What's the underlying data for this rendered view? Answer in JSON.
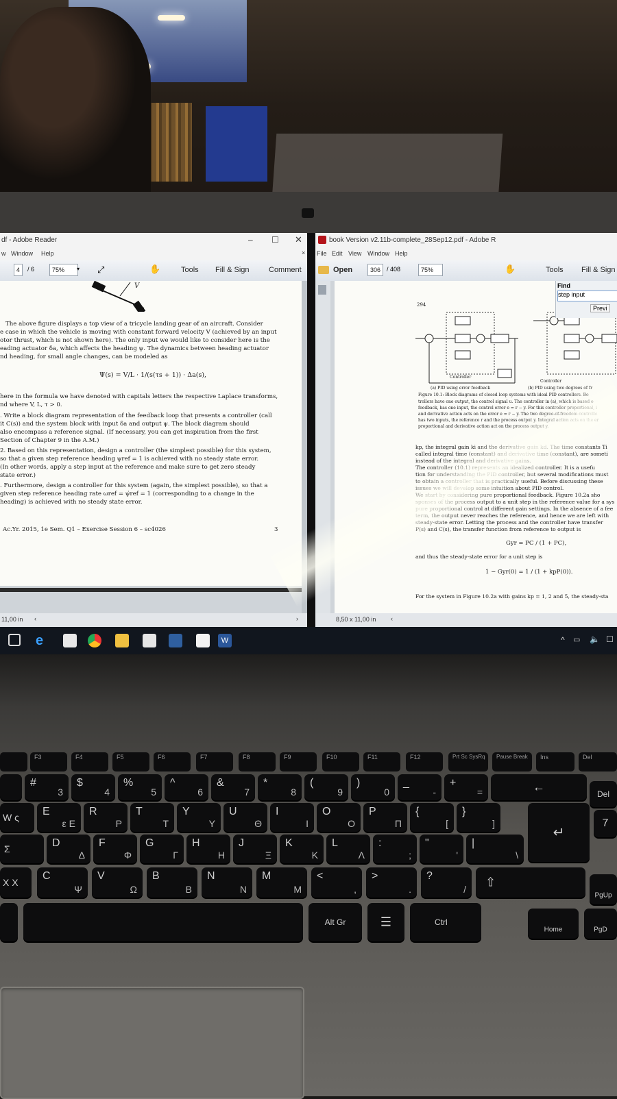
{
  "left_window": {
    "title": "df - Adobe Reader",
    "menu": [
      "w",
      "Window",
      "Help"
    ],
    "page_current": "4",
    "page_total": "/ 6",
    "zoom": "75%",
    "tools": [
      "Tools",
      "Fill & Sign",
      "Comment"
    ],
    "fig_label": "V",
    "lines": [
      "The above figure displays a top view of a tricycle landing gear of an aircraft.  Consider",
      "e case in which the vehicle is moving with constant forward velocity V (achieved by an input",
      "otor thrust, which is not shown here).  The only input we would like to consider here is the",
      "eading actuator δa, which affects the heading ψ.  The dynamics between heading actuator",
      "nd heading, for small angle changes, can be modeled as",
      "Ψ(s) =  V/L · 1/(s(τs + 1)) · Δa(s),",
      "here in the formula we have denoted with capitals letters the respective Laplace transforms,",
      "nd where V, L, τ > 0.",
      ".  Write a block diagram representation of the feedback loop that presents a controller (call",
      "   it C(s)) and the system block with input δa and output ψ. The block diagram should",
      "   also encompass a reference signal.  (If necessary, you can get inspiration from the first",
      "   Section of Chapter 9 in the A.M.)",
      "2.  Based on this representation, design a controller (the simplest possible) for this system,",
      "   so that a given step reference heading ψref = 1 is achieved with no steady state error.",
      "   (In other words, apply a step input at the reference and make sure to get zero steady",
      "   state error.)",
      ".  Furthermore, design a controller for this system (again, the simplest possible), so that a",
      "   given step reference heading rate ωref = ψ̇ref = 1 (corresponding to a change in the",
      "   heading) is achieved with no steady state error."
    ],
    "footer_left": "Ac.Yr. 2015, 1e Sem. Q1 – Exercise Session 6 – sc4026",
    "footer_page": "3",
    "status_size": "11,00 in"
  },
  "right_window": {
    "title": "book Version v2.11b-complete_28Sep12.pdf - Adobe R",
    "menu": [
      "File",
      "Edit",
      "View",
      "Window",
      "Help"
    ],
    "open": "Open",
    "page_current": "306",
    "page_total": "/ 408",
    "zoom": "75%",
    "tools": [
      "Tools",
      "Fill & Sign"
    ],
    "find_label": "Find",
    "find_value": "step input",
    "find_prev": "Previ",
    "page_number": "294",
    "controller_label": "Controller",
    "caption_a": "(a) PID using error feedback",
    "caption_b": "(b) PID using two degrees of fr",
    "figure_caption": [
      "Figure 10.1: Block diagrams of closed loop systems with ideal PID controllers. Bo",
      "trollers have one output, the control signal u. The controller in (a), which is based o",
      "feedback, has one input, the control error e = r − y. For this controller proportional, i",
      "and derivative action acts on the error e = r − y. The two degree-of-freedom controlle",
      "has two inputs, the reference r and the process output y. Integral action acts on the er",
      "proportional and derivative action act on the process output y."
    ],
    "body": [
      "kp, the integral gain ki and the derivative gain kd. The time constants Ti",
      "called integral time (constant) and derivative time (constant), are someti",
      "instead of the integral and derivative gains.",
      "   The controller (10.1) represents an idealized controller. It is a usefu",
      "tion for understanding the PID controller, but several modifications must",
      "to obtain a controller that is practically useful. Before discussing these",
      "issues we will develop some intuition about PID control.",
      "   We start by considering pure proportional feedback. Figure 10.2a sho",
      "sponses of the process output to a unit step in the reference value for a sys",
      "pure proportional control at different gain settings. In the absence of a fee",
      "term, the output never reaches the reference, and hence we are left with",
      "steady-state error. Letting the process and the controller have transfer",
      "P(s) and C(s), the transfer function from reference to output is"
    ],
    "eq1": "Gyr = PC / (1 + PC),",
    "after_eq1": "and thus the steady-state error for a unit step is",
    "eq2": "1 − Gyr(0) = 1 / (1 + kpP(0)).",
    "last_line": "For the system in Figure 10.2a with gains kp = 1, 2 and 5, the steady-sta",
    "status_size": "8,50 x 11,00 in"
  },
  "taskbar": {
    "icons": [
      "task-view-icon",
      "edge-icon",
      "store-icon",
      "chrome-icon",
      "file-explorer-icon",
      "mail-icon",
      "network-icon",
      "pdf-icon",
      "word-icon"
    ],
    "word_label": "W"
  },
  "keyboard": {
    "fkeys": [
      "F3",
      "F4",
      "F5",
      "F6",
      "F7",
      "F8",
      "F9",
      "F10",
      "F11",
      "F12",
      "Prt Sc SysRq",
      "Pause Break",
      "Ins",
      "Del"
    ],
    "row1": [
      {
        "u": "#",
        "l": "3"
      },
      {
        "u": "$",
        "l": "4"
      },
      {
        "u": "%",
        "l": "5"
      },
      {
        "u": "^",
        "l": "6"
      },
      {
        "u": "&",
        "l": "7"
      },
      {
        "u": "*",
        "l": "8"
      },
      {
        "u": "(",
        "l": "9"
      },
      {
        "u": ")",
        "l": "0"
      },
      {
        "u": "_",
        "l": "-"
      },
      {
        "u": "+",
        "l": "="
      }
    ],
    "row2": [
      {
        "u": "E",
        "l": "ε Ε"
      },
      {
        "u": "R",
        "l": "P"
      },
      {
        "u": "T",
        "l": "T"
      },
      {
        "u": "Y",
        "l": "Y"
      },
      {
        "u": "U",
        "l": "Θ"
      },
      {
        "u": "I",
        "l": "I"
      },
      {
        "u": "O",
        "l": "O"
      },
      {
        "u": "P",
        "l": "Π"
      },
      {
        "u": "{",
        "l": "["
      },
      {
        "u": "}",
        "l": "]"
      }
    ],
    "row3": [
      {
        "u": "D",
        "l": "Δ"
      },
      {
        "u": "F",
        "l": "Φ"
      },
      {
        "u": "G",
        "l": "Γ"
      },
      {
        "u": "H",
        "l": "H"
      },
      {
        "u": "J",
        "l": "Ξ"
      },
      {
        "u": "K",
        "l": "K"
      },
      {
        "u": "L",
        "l": "Λ"
      },
      {
        "u": ":",
        "l": ";"
      },
      {
        "u": "\"",
        "l": "'"
      },
      {
        "u": "|",
        "l": "\\"
      }
    ],
    "row4": [
      {
        "u": "C",
        "l": "Ψ"
      },
      {
        "u": "V",
        "l": "Ω"
      },
      {
        "u": "B",
        "l": "B"
      },
      {
        "u": "N",
        "l": "N"
      },
      {
        "u": "M",
        "l": "M"
      },
      {
        "u": "<",
        "l": ","
      },
      {
        "u": ">",
        "l": "."
      },
      {
        "u": "?",
        "l": "/"
      }
    ],
    "left_partial": [
      "W ς",
      "Σ",
      "X X"
    ],
    "del_label": "Del",
    "backspace_arrow": "←",
    "enter_arrow": "↵",
    "shift_arrow": "⇧",
    "pgup": "PgUp",
    "home": "Home",
    "pgd": "PgD",
    "altgr": "Alt Gr",
    "menu_key": "☰",
    "ctrl": "Ctrl",
    "seven": "7"
  }
}
